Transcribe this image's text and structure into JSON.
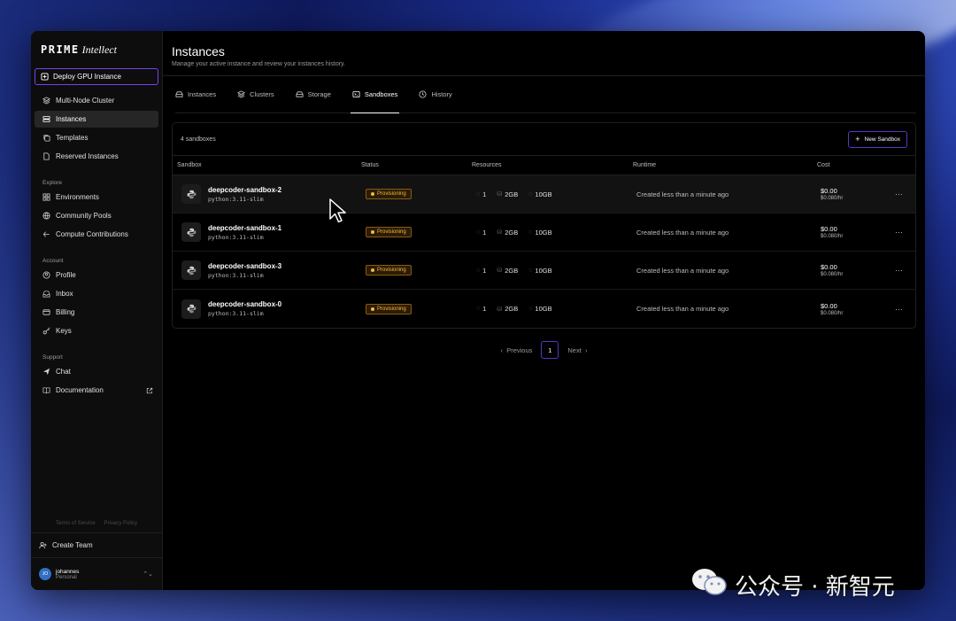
{
  "brand": {
    "name_mono": "PRIME",
    "name_italic": "Intellect"
  },
  "sidebar": {
    "deploy_label": "Deploy GPU Instance",
    "primary": [
      {
        "label": "Multi-Node Cluster",
        "icon": "layers-icon",
        "active": false
      },
      {
        "label": "Instances",
        "icon": "server-icon",
        "active": true
      },
      {
        "label": "Templates",
        "icon": "copy-icon",
        "active": false
      },
      {
        "label": "Reserved Instances",
        "icon": "file-icon",
        "active": false
      }
    ],
    "explore_label": "Explore",
    "explore": [
      {
        "label": "Environments",
        "icon": "grid-icon"
      },
      {
        "label": "Community Pools",
        "icon": "globe-icon"
      },
      {
        "label": "Compute Contributions",
        "icon": "share-icon"
      }
    ],
    "account_label": "Account",
    "account": [
      {
        "label": "Profile",
        "icon": "user-icon"
      },
      {
        "label": "Inbox",
        "icon": "inbox-icon"
      },
      {
        "label": "Billing",
        "icon": "card-icon"
      },
      {
        "label": "Keys",
        "icon": "key-icon"
      }
    ],
    "support_label": "Support",
    "support": [
      {
        "label": "Chat",
        "icon": "send-icon"
      },
      {
        "label": "Documentation",
        "icon": "book-icon"
      }
    ],
    "terms": "Terms of Service",
    "privacy": "Privacy Policy",
    "create_team": "Create Team",
    "user": {
      "initials": "JO",
      "name": "johannes",
      "plan": "Personal"
    }
  },
  "header": {
    "title": "Instances",
    "subtitle": "Manage your active instance and review your instances history."
  },
  "tabs": [
    {
      "label": "Instances",
      "icon": "server-icon",
      "active": false
    },
    {
      "label": "Clusters",
      "icon": "layers-icon",
      "active": false
    },
    {
      "label": "Storage",
      "icon": "drive-icon",
      "active": false
    },
    {
      "label": "Sandboxes",
      "icon": "terminal-icon",
      "active": true
    },
    {
      "label": "History",
      "icon": "clock-icon",
      "active": false
    }
  ],
  "panel": {
    "count": "4 sandboxes",
    "new_button": "New Sandbox",
    "columns": [
      "Sandbox",
      "Status",
      "Resources",
      "Runtime",
      "Cost"
    ],
    "rows": [
      {
        "name": "deepcoder-sandbox-2",
        "image": "python:3.11-slim",
        "status": "Provisioning",
        "cpu": "1",
        "mem": "2GB",
        "disk": "10GB",
        "runtime": "Created less than a minute ago",
        "cost": "$0.00",
        "rate": "$0.080/hr"
      },
      {
        "name": "deepcoder-sandbox-1",
        "image": "python:3.11-slim",
        "status": "Provisioning",
        "cpu": "1",
        "mem": "2GB",
        "disk": "10GB",
        "runtime": "Created less than a minute ago",
        "cost": "$0.00",
        "rate": "$0.080/hr"
      },
      {
        "name": "deepcoder-sandbox-3",
        "image": "python:3.11-slim",
        "status": "Provisioning",
        "cpu": "1",
        "mem": "2GB",
        "disk": "10GB",
        "runtime": "Created less than a minute ago",
        "cost": "$0.00",
        "rate": "$0.080/hr"
      },
      {
        "name": "deepcoder-sandbox-0",
        "image": "python:3.11-slim",
        "status": "Provisioning",
        "cpu": "1",
        "mem": "2GB",
        "disk": "10GB",
        "runtime": "Created less than a minute ago",
        "cost": "$0.00",
        "rate": "$0.080/hr"
      }
    ]
  },
  "pager": {
    "prev": "Previous",
    "page": "1",
    "next": "Next"
  },
  "watermark": {
    "text": "公众号 · 新智元"
  },
  "colors": {
    "accent": "#7b3ff2",
    "status_warning": "#f5b83d",
    "background": "#000000"
  }
}
